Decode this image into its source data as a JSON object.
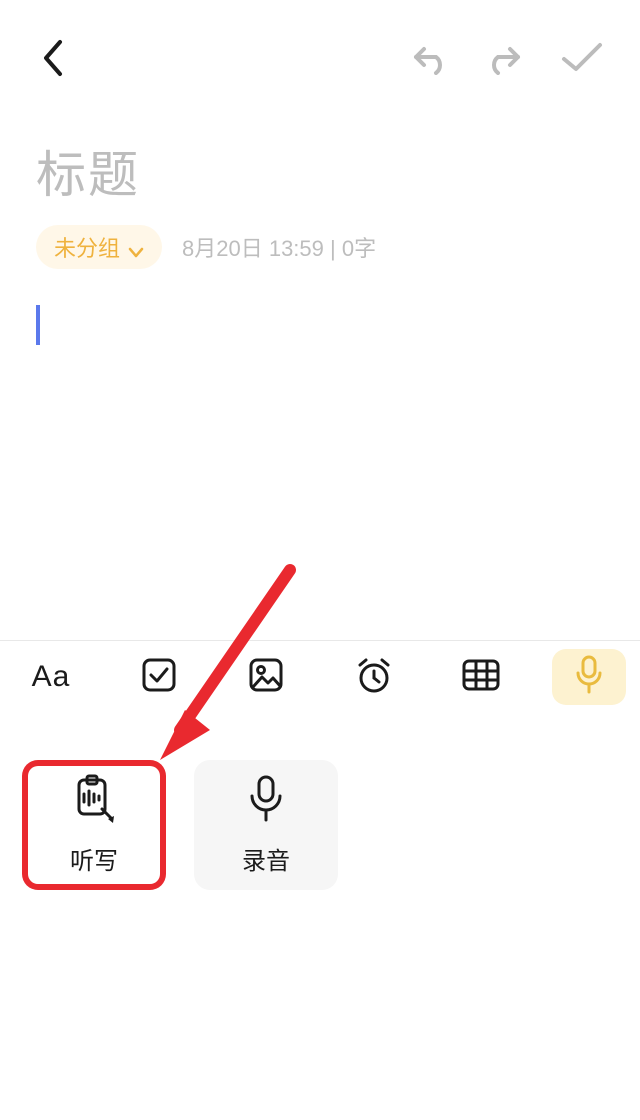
{
  "title": {
    "placeholder": "标题"
  },
  "group_chip": {
    "label": "未分组"
  },
  "meta": {
    "text": "8月20日 13:59  |  0字"
  },
  "toolbar": {
    "text_style": "Aa"
  },
  "voice": {
    "dictation": {
      "label": "听写"
    },
    "recording": {
      "label": "录音"
    }
  }
}
